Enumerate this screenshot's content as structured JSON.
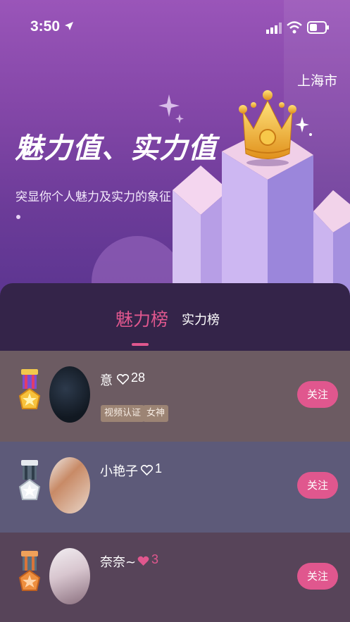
{
  "status_bar": {
    "time": "3:50"
  },
  "header": {
    "city": "上海市",
    "title": "魅力值、实力值",
    "subtitle": "突显你个人魅力及实力的象征"
  },
  "tabs": [
    {
      "label": "魅力榜",
      "active": true
    },
    {
      "label": "实力榜",
      "active": false
    }
  ],
  "rankings": [
    {
      "rank": 1,
      "medal": "gold-medal-icon",
      "name": "意",
      "heart_count": "28",
      "tags": [
        "视频认证",
        "女神"
      ],
      "follow_label": "关注"
    },
    {
      "rank": 2,
      "medal": "silver-medal-icon",
      "name": "小艳子",
      "heart_count": "1",
      "tags": [],
      "follow_label": "关注"
    },
    {
      "rank": 3,
      "medal": "bronze-medal-icon",
      "name": "奈奈~",
      "heart_count": "3",
      "tags": [],
      "follow_label": "关注"
    }
  ],
  "colors": {
    "accent": "#e0578e",
    "hero_top": "#9a55b9",
    "tab_panel": "#342449"
  }
}
